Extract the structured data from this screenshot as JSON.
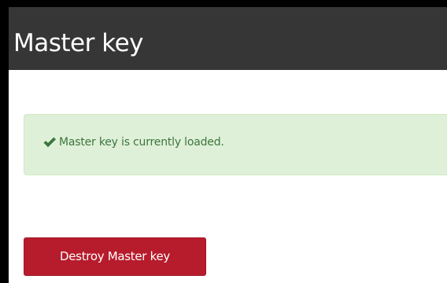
{
  "panel": {
    "title": "Master key"
  },
  "alert": {
    "icon": "checkmark-icon",
    "message": "Master key is currently loaded.",
    "colors": {
      "background": "#dff0d8",
      "text": "#3c763d"
    }
  },
  "actions": {
    "destroy_label": "Destroy Master key",
    "destroy_color": "#b71c2c"
  },
  "header_color": "#363636"
}
